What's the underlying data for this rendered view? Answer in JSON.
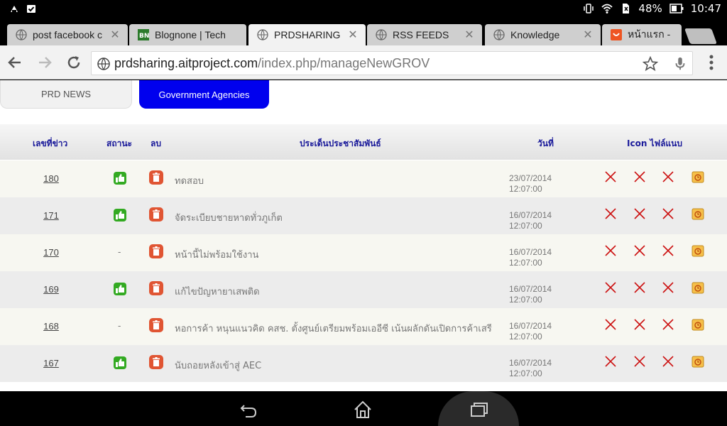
{
  "status_bar": {
    "battery_percent": "48%",
    "time": "10:47"
  },
  "tabs": [
    {
      "title": "post facebook c",
      "favicon": "globe-icon",
      "active": false
    },
    {
      "title": "Blognone | Tech",
      "favicon": "bn-icon",
      "active": false
    },
    {
      "title": "PRDSHARING",
      "favicon": "globe-icon",
      "active": true
    },
    {
      "title": "RSS FEEDS",
      "favicon": "globe-icon",
      "active": false
    },
    {
      "title": "Knowledge",
      "favicon": "globe-icon",
      "active": false
    },
    {
      "title": "หน้าแรก -",
      "favicon": "pantip-icon",
      "active": false
    }
  ],
  "omnibox": {
    "domain": "prdsharing.aitproject.com",
    "path": "/index.php/manageNewGROV"
  },
  "filters": {
    "prd_news": "PRD NEWS",
    "government": "Government Agencies"
  },
  "table": {
    "headers": {
      "id": "เลขที่ข่าว",
      "status": "สถานะ",
      "delete": "ลบ",
      "topic": "ประเด็นประชาสัมพันธ์",
      "date": "วันที่",
      "files": "Icon ไฟล์แนบ"
    },
    "rows": [
      {
        "id": "180",
        "status": "approved",
        "status_text": "",
        "title": "ทดสอบ",
        "date": "23/07/2014",
        "time": "12:07:00"
      },
      {
        "id": "171",
        "status": "approved",
        "status_text": "",
        "title": "จัดระเบียบชายหาดทั่วภูเก็ต",
        "date": "16/07/2014",
        "time": "12:07:00"
      },
      {
        "id": "170",
        "status": "none",
        "status_text": "-",
        "title": "หน้านี้ไม่พร้อมใช้งาน",
        "date": "16/07/2014",
        "time": "12:07:00"
      },
      {
        "id": "169",
        "status": "approved",
        "status_text": "",
        "title": "แก้ไขปัญหายาเสพติด",
        "date": "16/07/2014",
        "time": "12:07:00"
      },
      {
        "id": "168",
        "status": "none",
        "status_text": "-",
        "title": "หอการค้า หนุนแนวคิด คสช. ตั้งศูนย์เตรียมพร้อมเออีซี เน้นผลักดันเปิดการค้าเสรี",
        "date": "16/07/2014",
        "time": "12:07:00"
      },
      {
        "id": "167",
        "status": "approved",
        "status_text": "",
        "title": "นับถอยหลังเข้าสู่ AEC",
        "date": "16/07/2014",
        "time": "12:07:00"
      }
    ]
  },
  "colors": {
    "accent_blue": "#0000ee",
    "header_text": "#1a1a9a",
    "x_red": "#cc1111",
    "approve_green": "#33aa22",
    "delete_orange": "#e05533"
  }
}
